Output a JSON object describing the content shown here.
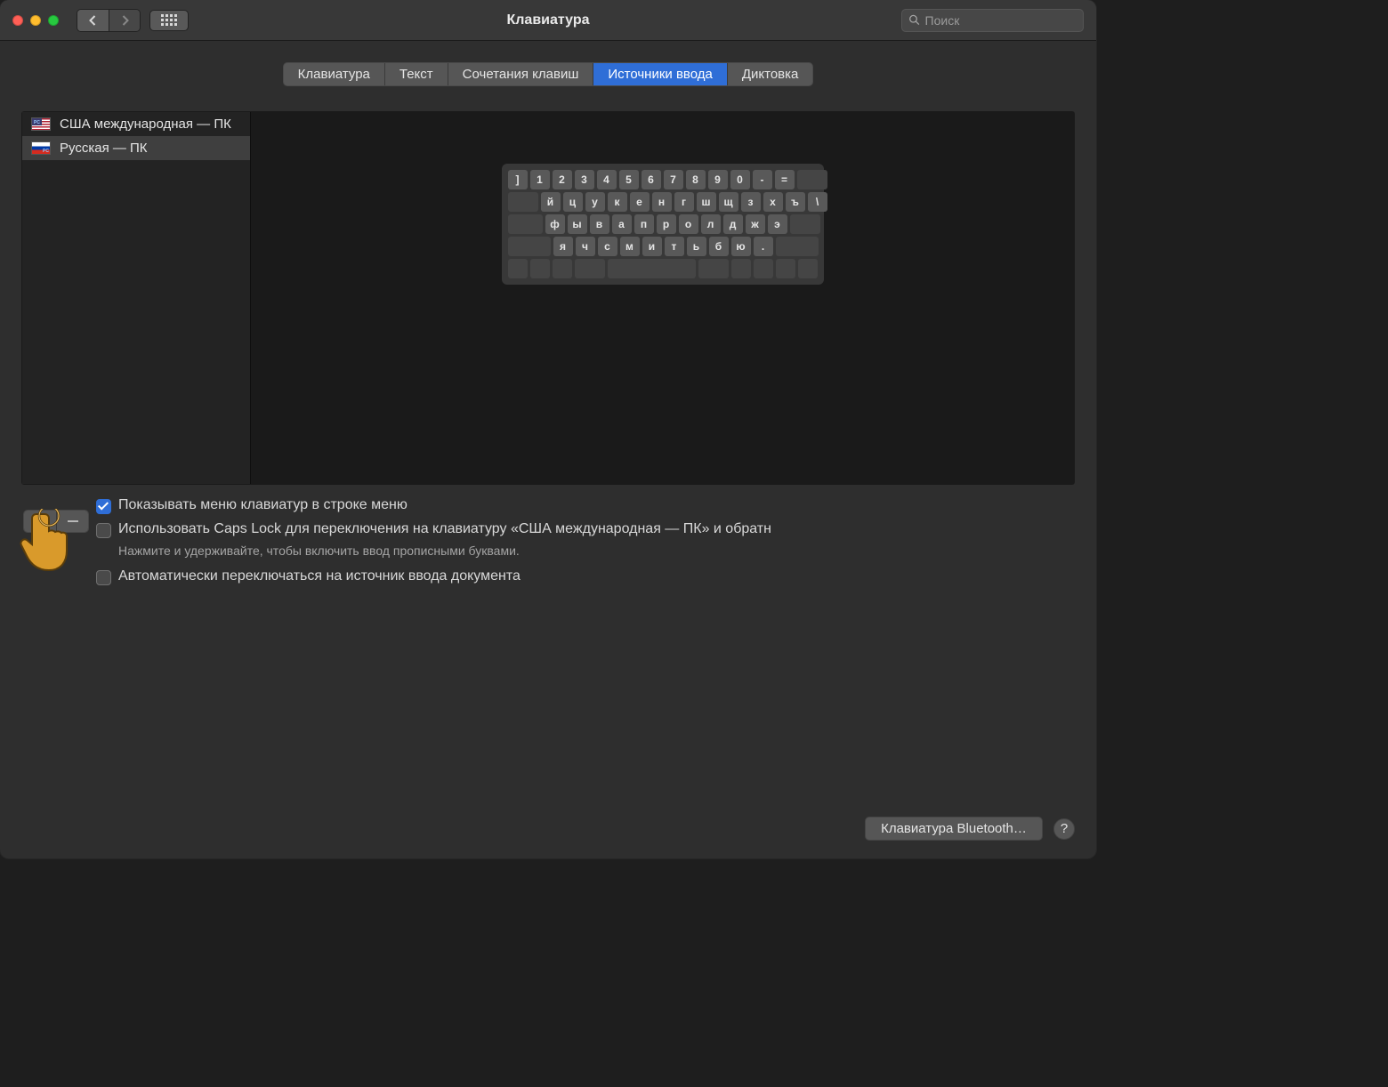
{
  "window": {
    "title": "Клавиатура",
    "search_placeholder": "Поиск"
  },
  "tabs": [
    {
      "label": "Клавиатура",
      "active": false
    },
    {
      "label": "Текст",
      "active": false
    },
    {
      "label": "Сочетания клавиш",
      "active": false
    },
    {
      "label": "Источники ввода",
      "active": true
    },
    {
      "label": "Диктовка",
      "active": false
    }
  ],
  "sources": [
    {
      "label": "США международная — ПК",
      "flag": "us"
    },
    {
      "label": "Русская — ПК",
      "flag": "ru",
      "selected": true
    }
  ],
  "keyboard_preview": {
    "rows": [
      [
        "]",
        "1",
        "2",
        "3",
        "4",
        "5",
        "6",
        "7",
        "8",
        "9",
        "0",
        "-",
        "="
      ],
      [
        "й",
        "ц",
        "у",
        "к",
        "е",
        "н",
        "г",
        "ш",
        "щ",
        "з",
        "х",
        "ъ",
        "\\"
      ],
      [
        "ф",
        "ы",
        "в",
        "а",
        "п",
        "р",
        "о",
        "л",
        "д",
        "ж",
        "э"
      ],
      [
        "я",
        "ч",
        "с",
        "м",
        "и",
        "т",
        "ь",
        "б",
        "ю",
        "."
      ]
    ]
  },
  "options": {
    "show_menu": {
      "label": "Показывать меню клавиатур в строке меню",
      "checked": true
    },
    "caps_lock": {
      "label": "Использовать Caps Lock для переключения на клавиатуру «США международная — ПК» и обратн",
      "checked": false
    },
    "caps_hint": "Нажмите и удерживайте, чтобы включить ввод прописными буквами.",
    "auto_switch": {
      "label": "Автоматически переключаться на источник ввода документа",
      "checked": false
    }
  },
  "footer": {
    "bluetooth": "Клавиатура Bluetooth…",
    "help": "?"
  }
}
